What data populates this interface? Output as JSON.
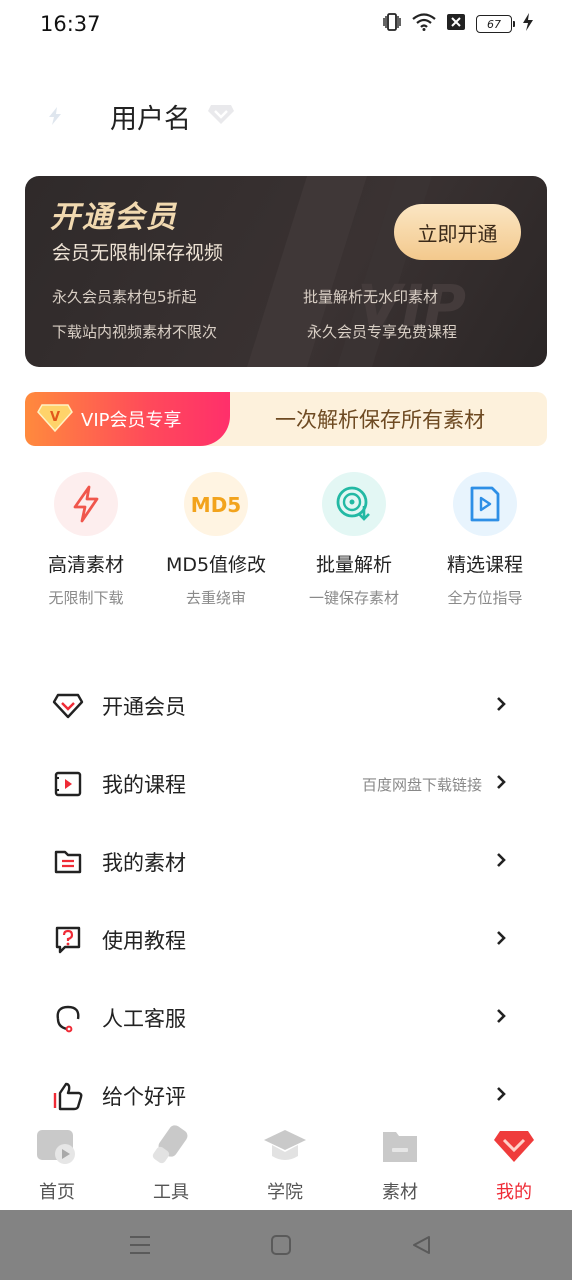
{
  "status_bar": {
    "time": "16:37",
    "battery": "67"
  },
  "profile": {
    "username": "用户名"
  },
  "vip_card": {
    "title": "开通会员",
    "subtitle": "会员无限制保存视频",
    "button": "立即开通",
    "features": [
      "永久会员素材包5折起",
      "批量解析无水印素材",
      "下载站内视频素材不限次",
      "永久会员专享免费课程"
    ],
    "watermark": "VIP"
  },
  "banner": {
    "left_label": "VIP会员专享",
    "right_text": "一次解析保存所有素材"
  },
  "features": [
    {
      "title": "高清素材",
      "sub": "无限制下载",
      "icon": "lightning-icon"
    },
    {
      "title": "MD5值修改",
      "sub": "去重绕审",
      "icon": "md5-icon",
      "badge": "MD5"
    },
    {
      "title": "批量解析",
      "sub": "一键保存素材",
      "icon": "disc-download-icon"
    },
    {
      "title": "精选课程",
      "sub": "全方位指导",
      "icon": "video-course-icon"
    }
  ],
  "menu": [
    {
      "label": "开通会员",
      "extra": "",
      "icon": "diamond-icon"
    },
    {
      "label": "我的课程",
      "extra": "百度网盘下载链接",
      "icon": "video-icon"
    },
    {
      "label": "我的素材",
      "extra": "",
      "icon": "folder-icon"
    },
    {
      "label": "使用教程",
      "extra": "",
      "icon": "question-icon"
    },
    {
      "label": "人工客服",
      "extra": "",
      "icon": "headset-icon"
    },
    {
      "label": "给个好评",
      "extra": "",
      "icon": "thumbs-up-icon"
    }
  ],
  "tabs": [
    {
      "label": "首页",
      "active": false
    },
    {
      "label": "工具",
      "active": false
    },
    {
      "label": "学院",
      "active": false
    },
    {
      "label": "素材",
      "active": false
    },
    {
      "label": "我的",
      "active": true
    }
  ],
  "colors": {
    "accent": "#ef2b36",
    "gold": "#f1d9b0",
    "card": "#2f2a2a"
  }
}
